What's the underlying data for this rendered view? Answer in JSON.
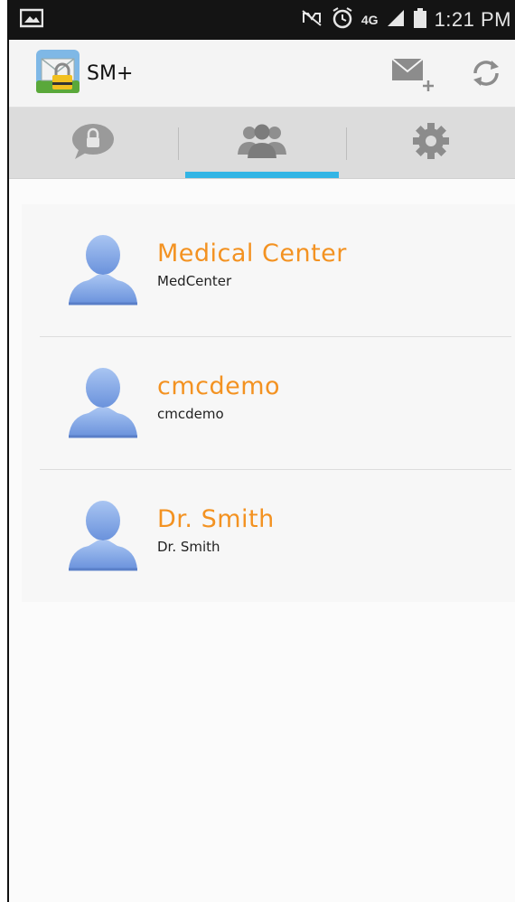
{
  "status_bar": {
    "time": "1:21 PM",
    "network": "4G",
    "icons": [
      "gallery-icon",
      "mute-icon",
      "alarm-icon",
      "signal-icon",
      "battery-icon"
    ]
  },
  "action_bar": {
    "app_title": "SM+",
    "icons": [
      "app-logo-icon",
      "compose-mail-icon",
      "refresh-icon"
    ]
  },
  "tabs": [
    {
      "icon": "lock-chat-icon",
      "active": false
    },
    {
      "icon": "contacts-icon",
      "active": true
    },
    {
      "icon": "gear-icon",
      "active": false
    }
  ],
  "contacts": [
    {
      "name": "Medical Center",
      "username": "MedCenter"
    },
    {
      "name": "cmcdemo",
      "username": "cmcdemo"
    },
    {
      "name": "Dr. Smith",
      "username": "Dr. Smith"
    }
  ],
  "colors": {
    "accent": "#33b5e5",
    "name_text": "#f39221",
    "avatar": "#7ea6e8",
    "status_bar": "#141414"
  }
}
